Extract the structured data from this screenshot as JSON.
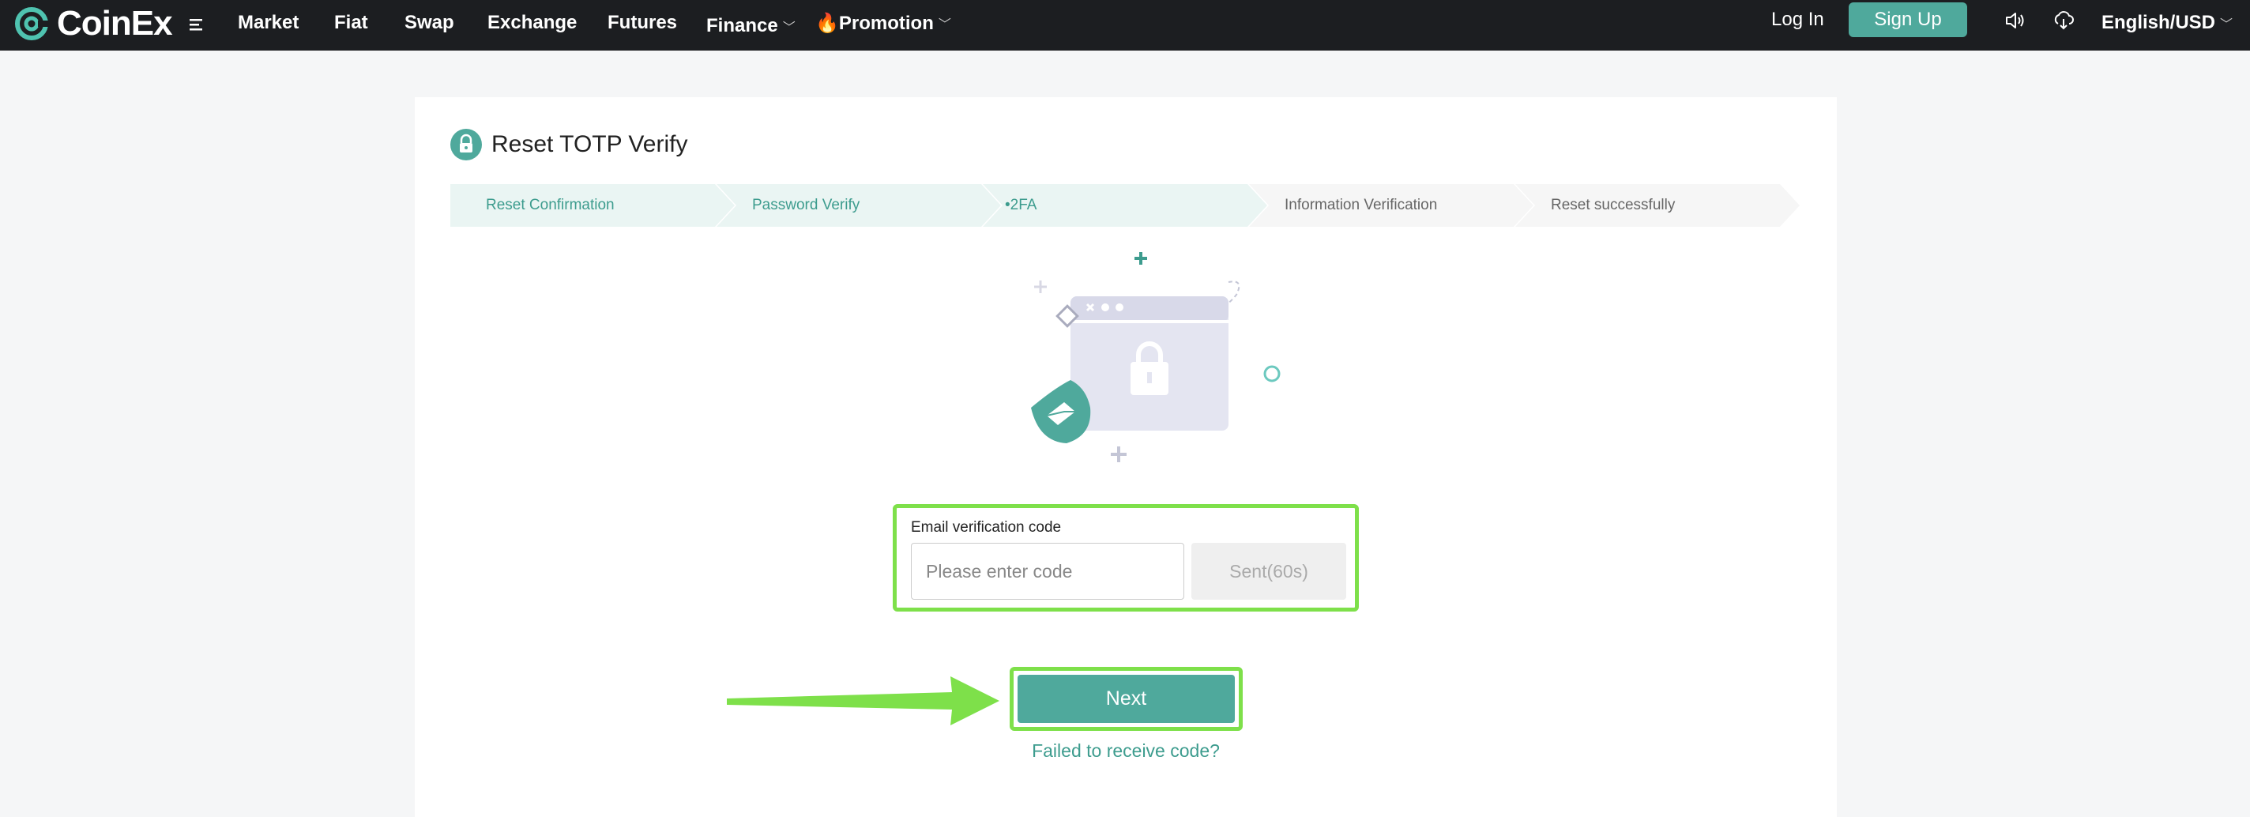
{
  "header": {
    "logo_text": "CoinEx",
    "nav": [
      {
        "label": "Market"
      },
      {
        "label": "Fiat"
      },
      {
        "label": "Swap"
      },
      {
        "label": "Exchange"
      },
      {
        "label": "Futures"
      },
      {
        "label": "Finance"
      },
      {
        "label": "🔥Promotion"
      }
    ],
    "login_label": "Log In",
    "signup_label": "Sign Up",
    "language": "English/USD"
  },
  "page": {
    "title": "Reset TOTP Verify",
    "steps": [
      {
        "label": "Reset Confirmation",
        "state": "done"
      },
      {
        "label": "Password Verify",
        "state": "done"
      },
      {
        "label": "•2FA",
        "state": "current"
      },
      {
        "label": "Information Verification",
        "state": "todo"
      },
      {
        "label": "Reset successfully",
        "state": "todo"
      }
    ],
    "code_label": "Email verification code",
    "code_placeholder": "Please enter code",
    "code_value": "",
    "sent_label": "Sent(60s)",
    "next_label": "Next",
    "failed_link": "Failed to receive code?"
  },
  "colors": {
    "brand": "#4fa99c",
    "header_bg": "#1c1e21",
    "highlight": "#7ee04a"
  },
  "icons": [
    "coinex-logo-icon",
    "menu-icon",
    "lock-icon",
    "speaker-icon",
    "download-icon",
    "chevron-down-icon",
    "arrow-right-icon"
  ]
}
